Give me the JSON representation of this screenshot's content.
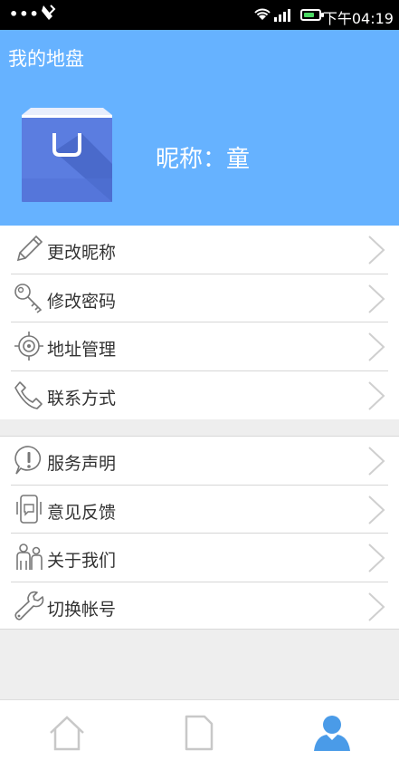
{
  "status_bar": {
    "time": "下午04:19",
    "battery_level": 0.7
  },
  "header": {
    "title": "我的地盘",
    "nickname": "昵称：童",
    "background_color": "#66b2ff"
  },
  "menu_group_1": [
    {
      "label": "更改昵称",
      "icon": "pencil-icon"
    },
    {
      "label": "修改密码",
      "icon": "key-icon"
    },
    {
      "label": "地址管理",
      "icon": "location-target-icon"
    },
    {
      "label": "联系方式",
      "icon": "phone-icon"
    }
  ],
  "menu_group_2": [
    {
      "label": "服务声明",
      "icon": "exclamation-bubble-icon"
    },
    {
      "label": "意见反馈",
      "icon": "feedback-phone-icon"
    },
    {
      "label": "关于我们",
      "icon": "people-icon"
    },
    {
      "label": "切换帐号",
      "icon": "wrench-icon"
    }
  ],
  "bottom_nav": [
    {
      "name": "home",
      "icon": "home-icon",
      "active": false
    },
    {
      "name": "document",
      "icon": "document-icon",
      "active": false
    },
    {
      "name": "user",
      "icon": "user-icon",
      "active": true
    }
  ],
  "colors": {
    "accent": "#4a9be8",
    "icon_inactive": "#c8c8c8"
  }
}
